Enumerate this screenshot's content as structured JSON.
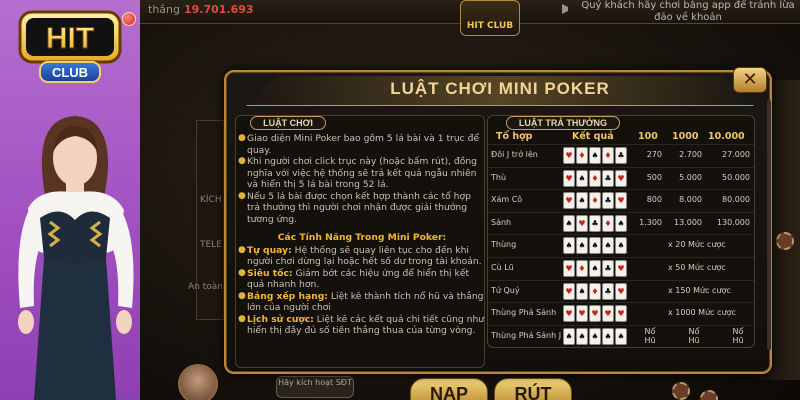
{
  "background": {
    "win_label": "thắng",
    "win_value": "19.701.693",
    "notice": "Quý khách hãy chơi bằng app để tránh lừa đảo về khoản",
    "logo_text": "HIT CLUB",
    "login_hint": "Hãy kích hoạt SĐT",
    "nap_label": "NẠP",
    "rut_label": "RÚT",
    "side_texts": [
      "KÍCH",
      "TELE",
      "An toàn"
    ]
  },
  "logo": {
    "hit": "HIT",
    "club": "CLUB"
  },
  "modal": {
    "title": "LUẬT CHƠI MINI POKER",
    "close_label": "✕",
    "rules_header": "LUẬT CHƠI",
    "payout_header": "LUẬT TRẢ THƯỞNG",
    "rules": [
      "Giao diện Mini Poker bao gồm 5 lá bài và 1 trục để quay.",
      "Khi người chơi click trục này (hoặc bấm rút), đồng nghĩa với việc hệ thống sẽ trả kết quả ngẫu nhiên và hiển thị 5 lá bài trong 52 lá.",
      "Nếu 5 lá bài được chọn kết hợp thành các tổ hợp trả thưởng thì người chơi nhận được giải thưởng tương ứng."
    ],
    "features_heading": "Các Tính Năng Trong Mini Poker:",
    "features": [
      {
        "name": "Tự quay:",
        "desc": " Hệ thống sẽ quay liên tục cho đến khi người chơi dừng lại hoặc hết số dư trong tài khoản."
      },
      {
        "name": "Siêu tốc:",
        "desc": " Giảm bớt các hiệu ứng để hiển thị kết quả nhanh hơn."
      },
      {
        "name": "Bảng xếp hạng:",
        "desc": " Liệt kê thành tích nổ hũ và thắng lớn của người chơi"
      },
      {
        "name": "Lịch sử cược:",
        "desc": " Liệt kê các kết quả chi tiết cũng như hiển thị đầy đủ số tiền thắng thua của từng vòng."
      }
    ],
    "table_headers": {
      "combo": "Tổ hợp",
      "result": "Kết quả",
      "c100": "100",
      "c1000": "1000",
      "c10000": "10.000"
    },
    "rows": [
      {
        "name": "Đôi J trở lên",
        "cards": [
          [
            "J",
            "♥",
            "r"
          ],
          [
            "J",
            "♦",
            "r"
          ],
          [
            "4",
            "♠",
            "b"
          ],
          [
            "9",
            "♦",
            "r"
          ],
          [
            "2",
            "♣",
            "b"
          ]
        ],
        "v100": "270",
        "v1000": "2.700",
        "v10000": "27.000"
      },
      {
        "name": "Thù",
        "cards": [
          [
            "5",
            "♥",
            "r"
          ],
          [
            "5",
            "♠",
            "b"
          ],
          [
            "8",
            "♦",
            "r"
          ],
          [
            "8",
            "♣",
            "b"
          ],
          [
            "K",
            "♥",
            "r"
          ]
        ],
        "v100": "500",
        "v1000": "5.000",
        "v10000": "50.000"
      },
      {
        "name": "Xám Cô",
        "cards": [
          [
            "7",
            "♥",
            "r"
          ],
          [
            "7",
            "♠",
            "b"
          ],
          [
            "7",
            "♦",
            "r"
          ],
          [
            "Q",
            "♣",
            "b"
          ],
          [
            "3",
            "♥",
            "r"
          ]
        ],
        "v100": "800",
        "v1000": "8.000",
        "v10000": "80.000"
      },
      {
        "name": "Sảnh",
        "cards": [
          [
            "6",
            "♠",
            "b"
          ],
          [
            "7",
            "♥",
            "r"
          ],
          [
            "8",
            "♣",
            "b"
          ],
          [
            "9",
            "♦",
            "r"
          ],
          [
            "10",
            "♠",
            "b"
          ]
        ],
        "v100": "1.300",
        "v1000": "13.000",
        "v10000": "130.000"
      },
      {
        "name": "Thùng",
        "cards": [
          [
            "2",
            "♠",
            "b"
          ],
          [
            "5",
            "♠",
            "b"
          ],
          [
            "8",
            "♠",
            "b"
          ],
          [
            "J",
            "♠",
            "b"
          ],
          [
            "K",
            "♠",
            "b"
          ]
        ],
        "span": "x 20 Mức cược"
      },
      {
        "name": "Cù Lũ",
        "cards": [
          [
            "Q",
            "♥",
            "r"
          ],
          [
            "Q",
            "♦",
            "r"
          ],
          [
            "Q",
            "♠",
            "b"
          ],
          [
            "4",
            "♣",
            "b"
          ],
          [
            "4",
            "♥",
            "r"
          ]
        ],
        "span": "x 50 Mức cược"
      },
      {
        "name": "Tứ Quý",
        "cards": [
          [
            "9",
            "♥",
            "r"
          ],
          [
            "9",
            "♠",
            "b"
          ],
          [
            "9",
            "♦",
            "r"
          ],
          [
            "9",
            "♣",
            "b"
          ],
          [
            "A",
            "♥",
            "r"
          ]
        ],
        "span": "x 150 Mức cược"
      },
      {
        "name": "Thùng Phá Sảnh",
        "cards": [
          [
            "5",
            "♥",
            "r"
          ],
          [
            "6",
            "♥",
            "r"
          ],
          [
            "7",
            "♥",
            "r"
          ],
          [
            "8",
            "♥",
            "r"
          ],
          [
            "9",
            "♥",
            "r"
          ]
        ],
        "span": "x 1000 Mức cược"
      },
      {
        "name": "Thùng Phá Sảnh J",
        "cards": [
          [
            "J",
            "♠",
            "b"
          ],
          [
            "Q",
            "♠",
            "b"
          ],
          [
            "K",
            "♠",
            "b"
          ],
          [
            "A",
            "♠",
            "b"
          ],
          [
            "10",
            "♠",
            "b"
          ]
        ],
        "nohu": "Nổ Hũ"
      }
    ]
  }
}
